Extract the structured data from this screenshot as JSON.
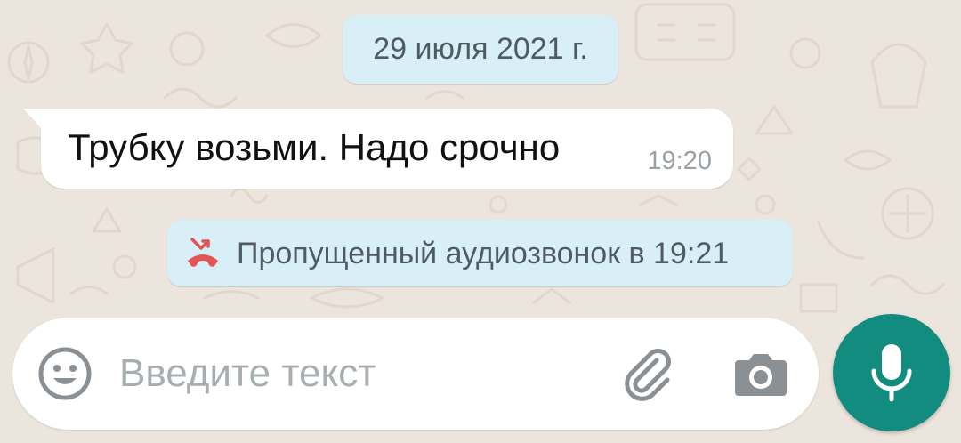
{
  "chat": {
    "date_chip": "29 июля 2021 г.",
    "message": {
      "text": "Трубку возьми. Надо срочно",
      "time": "19:20"
    },
    "missed_call": {
      "text": "Пропущенный аудиозвонок в 19:21",
      "icon": "missed-call-icon"
    }
  },
  "composer": {
    "placeholder": "Введите текст",
    "value": "",
    "emoji_icon": "emoji-icon",
    "attach_icon": "paperclip-icon",
    "camera_icon": "camera-icon",
    "mic_icon": "microphone-icon"
  },
  "colors": {
    "background": "#ece5dd",
    "system_chip": "#d9eff8",
    "incoming_bubble": "#ffffff",
    "accent": "#128c7e",
    "missed_call_red": "#e55353",
    "icon_gray": "#8a9094"
  }
}
